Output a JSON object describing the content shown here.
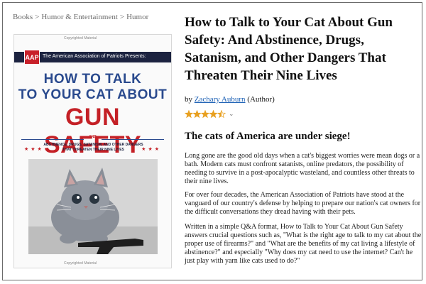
{
  "breadcrumb": {
    "items": [
      "Books",
      "Humor & Entertainment",
      "Humor"
    ],
    "separator": ">"
  },
  "cover": {
    "watermark_top": "Copyrighted Material",
    "publisher_badge": "AAP",
    "publisher": "The American Association of Patriots Presents:",
    "title_line1": "HOW TO TALK",
    "title_line2": "TO YOUR CAT ABOUT",
    "title_line3": "GUN SAFETY",
    "and_label": "AND",
    "subtitle": "ABSTINENCE, DRUGS, SATANISM, AND OTHER DANGERS THAT THREATEN THEIR NINE LIVES",
    "stars": "★★★",
    "watermark_bottom": "Copyrighted Material",
    "colors": {
      "navy": "#1c2340",
      "red": "#c42026",
      "blue": "#2a4a8e"
    }
  },
  "product": {
    "title": "How to Talk to Your Cat About Gun Safety: And Abstinence, Drugs, Satanism, and Other Dangers That Threaten Their Nine Lives",
    "by_label": "by",
    "author": "Zachary Auburn",
    "author_role": "(Author)",
    "rating": 4.5,
    "rating_max": 5,
    "star_color": "#e8a020",
    "chevron_icon": "chevron-down-icon"
  },
  "description": {
    "headline": "The cats of America are under siege!",
    "paragraphs": [
      "Long gone are the good old days when a cat's biggest worries were mean dogs or a bath. Modern cats must confront satanists, online predators, the possibility of needing to survive in a post-apocalyptic wasteland, and countless other threats to their nine lives.",
      "For over four decades, the American Association of Patriots have stood at the vanguard of our country's defense by helping to prepare our nation's cat owners for the difficult conversations they dread having with their pets.",
      "Written in a simple Q&A format, How to Talk to Your Cat About Gun Safety answers crucial questions such as, \"What is the right age to talk to my cat about the proper use of firearms?\" and \"What are the benefits of my cat living a lifestyle of abstinence?\" and especially \"Why does my cat need to use the internet? Can't he just play with yarn like cats used to do?\""
    ]
  }
}
